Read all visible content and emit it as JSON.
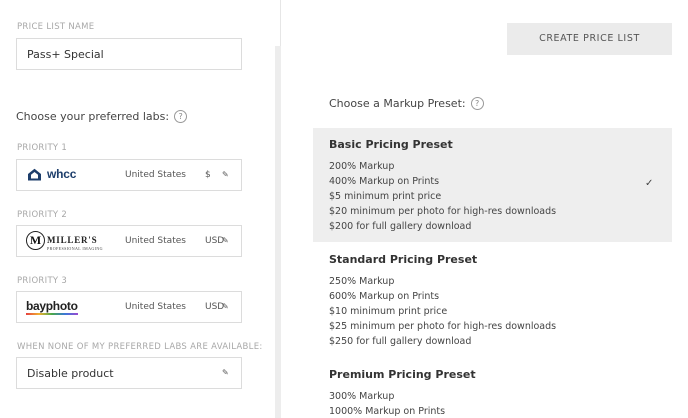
{
  "price_list": {
    "caption": "PRICE LIST NAME",
    "name": "Pass+ Special"
  },
  "labs": {
    "heading": "Choose your preferred labs:",
    "help_icon": "?",
    "edit_icon": "✎",
    "priorities": [
      {
        "caption": "PRIORITY 1",
        "lab": "whcc",
        "country": "United States",
        "currency": "$"
      },
      {
        "caption": "PRIORITY 2",
        "lab": "Miller's Professional Imaging",
        "logo_main": "MILLER'S",
        "logo_sub": "PROFESSIONAL IMAGING",
        "logo_letter": "M",
        "country": "United States",
        "currency": "USD"
      },
      {
        "caption": "PRIORITY 3",
        "lab": "bayphoto",
        "country": "United States",
        "currency": "USD"
      }
    ],
    "fallback_caption": "WHEN NONE OF MY PREFERRED LABS ARE AVAILABLE:",
    "fallback_value": "Disable product"
  },
  "create_button": "CREATE PRICE LIST",
  "presets": {
    "heading": "Choose a Markup Preset:",
    "help_icon": "?",
    "check_icon": "✓",
    "items": [
      {
        "title": "Basic Pricing Preset",
        "selected": true,
        "lines": [
          "200% Markup",
          "400% Markup on Prints",
          "$5 minimum print price",
          "$20 minimum per photo for high-res downloads",
          "$200 for full gallery download"
        ]
      },
      {
        "title": "Standard Pricing Preset",
        "selected": false,
        "lines": [
          "250% Markup",
          "600% Markup on Prints",
          "$10 minimum print price",
          "$25 minimum per photo for high-res downloads",
          "$250 for full gallery download"
        ]
      },
      {
        "title": "Premium Pricing Preset",
        "selected": false,
        "lines": [
          "300% Markup",
          "1000% Markup on Prints"
        ]
      }
    ]
  },
  "colors": {
    "selected_preset_bg": "#eeeeee",
    "button_bg": "#ebebeb",
    "whcc_brand": "#1d3e6b"
  }
}
